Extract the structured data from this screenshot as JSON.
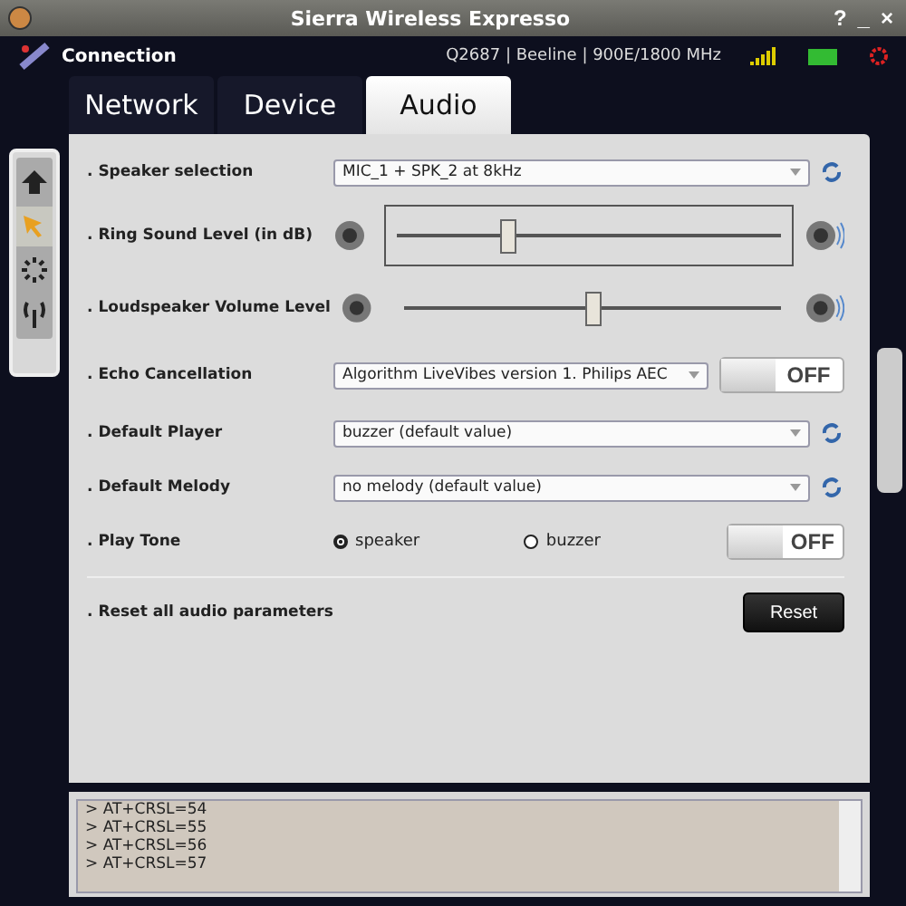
{
  "window": {
    "title": "Sierra Wireless Expresso",
    "controls": [
      "?",
      "_",
      "×"
    ]
  },
  "header": {
    "label": "Connection",
    "status": "Q2687 | Beeline | 900E/1800 MHz"
  },
  "tabs": [
    {
      "label": "Network",
      "selected": false
    },
    {
      "label": "Device",
      "selected": false
    },
    {
      "label": "Audio",
      "selected": true
    }
  ],
  "sidebar": {
    "items": [
      {
        "selected": false
      },
      {
        "selected": true
      },
      {
        "selected": false
      },
      {
        "selected": false
      }
    ]
  },
  "settings": [
    {
      "kind": "select",
      "label": ". Speaker selection",
      "value": "MIC_1 + SPK_2 at 8kHz"
    },
    {
      "kind": "slider",
      "label": ". Ring Sound Level (in dB)",
      "level": 0.3,
      "framed": true
    },
    {
      "kind": "slider",
      "label": ". Loudspeaker Volume Level",
      "level": 0.5,
      "framed": false
    },
    {
      "kind": "toggle_select",
      "label": ". Echo Cancellation",
      "value": "Algorithm LiveVibes version 1. Philips AEC",
      "toggle": {
        "label": "OFF",
        "on": false
      }
    },
    {
      "kind": "select",
      "label": ". Default Player",
      "value": "buzzer (default value)"
    },
    {
      "kind": "select",
      "label": ". Default Melody",
      "value": "no melody (default value)"
    },
    {
      "kind": "radio",
      "label": ". Play Tone",
      "options": [
        {
          "label": "speaker",
          "selected": true
        },
        {
          "label": "buzzer",
          "selected": false
        }
      ],
      "toggle": {
        "label": "OFF",
        "on": false
      }
    },
    {
      "kind": "reset",
      "label": ". Reset all audio parameters",
      "button": "Reset"
    }
  ],
  "log": [
    "> AT+CRSL=54",
    "> AT+CRSL=55",
    "> AT+CRSL=56",
    "> AT+CRSL=57"
  ]
}
